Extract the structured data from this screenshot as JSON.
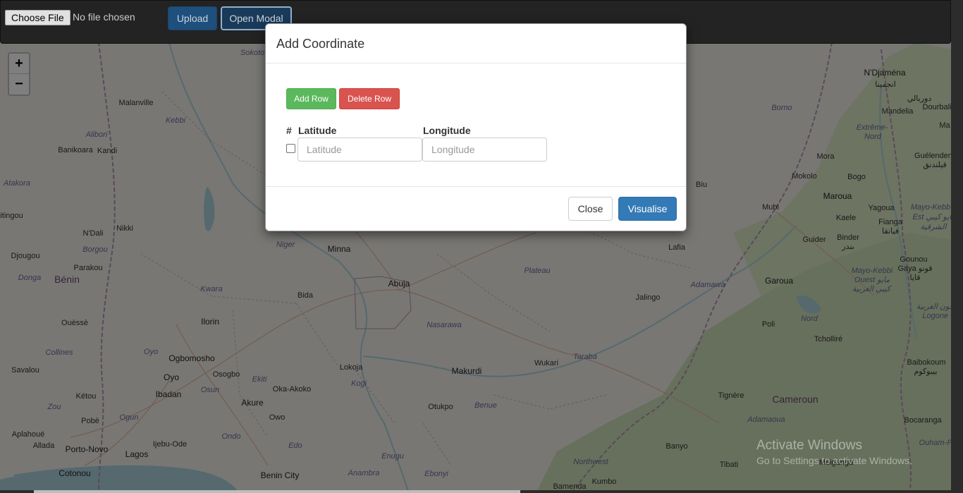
{
  "toolbar": {
    "file_button_label": "Choose File",
    "file_status": "No file chosen",
    "upload_label": "Upload",
    "open_modal_label": "Open Modal"
  },
  "map": {
    "zoom_in": "+",
    "zoom_out": "−",
    "places": [
      {
        "name": "Sokoto",
        "kind": "region"
      },
      {
        "name": "Malanville",
        "kind": "town"
      },
      {
        "name": "Kebbi",
        "kind": "region"
      },
      {
        "name": "Alibori",
        "kind": "region"
      },
      {
        "name": "Banikoara",
        "kind": "town"
      },
      {
        "name": "Kandi",
        "kind": "town"
      },
      {
        "name": "Atakora",
        "kind": "region"
      },
      {
        "name": "titingou",
        "kind": "town"
      },
      {
        "name": "Nikki",
        "kind": "town"
      },
      {
        "name": "N'Dali",
        "kind": "town"
      },
      {
        "name": "Borgou",
        "kind": "region"
      },
      {
        "name": "Djougou",
        "kind": "town"
      },
      {
        "name": "Parakou",
        "kind": "town"
      },
      {
        "name": "Donga",
        "kind": "region"
      },
      {
        "name": "Bénin",
        "kind": "country"
      },
      {
        "name": "Kwara",
        "kind": "region"
      },
      {
        "name": "Niger",
        "kind": "region"
      },
      {
        "name": "Minna",
        "kind": "city"
      },
      {
        "name": "Bida",
        "kind": "town"
      },
      {
        "name": "Abuja",
        "kind": "city"
      },
      {
        "name": "Plateau",
        "kind": "region"
      },
      {
        "name": "Lafia",
        "kind": "town"
      },
      {
        "name": "Ouèssè",
        "kind": "town"
      },
      {
        "name": "Ilorin",
        "kind": "city"
      },
      {
        "name": "Nasarawa",
        "kind": "region"
      },
      {
        "name": "Jalingo",
        "kind": "town"
      },
      {
        "name": "Adamawa",
        "kind": "region"
      },
      {
        "name": "Collines",
        "kind": "region"
      },
      {
        "name": "Oyo",
        "kind": "region"
      },
      {
        "name": "Ogbomosho",
        "kind": "city"
      },
      {
        "name": "Savalou",
        "kind": "town"
      },
      {
        "name": "Oyo",
        "kind": "city"
      },
      {
        "name": "Osogbo",
        "kind": "town"
      },
      {
        "name": "Ekiti",
        "kind": "region"
      },
      {
        "name": "Lokoja",
        "kind": "town"
      },
      {
        "name": "Makurdi",
        "kind": "city"
      },
      {
        "name": "Wukari",
        "kind": "town"
      },
      {
        "name": "Taraba",
        "kind": "region"
      },
      {
        "name": "Ibadan",
        "kind": "city"
      },
      {
        "name": "Osun",
        "kind": "region"
      },
      {
        "name": "Oka-Akoko",
        "kind": "town"
      },
      {
        "name": "Kogi",
        "kind": "region"
      },
      {
        "name": "Kétou",
        "kind": "town"
      },
      {
        "name": "Akure",
        "kind": "city"
      },
      {
        "name": "Benue",
        "kind": "region"
      },
      {
        "name": "Otukpo",
        "kind": "town"
      },
      {
        "name": "Zou",
        "kind": "region"
      },
      {
        "name": "Ogun",
        "kind": "region"
      },
      {
        "name": "Owo",
        "kind": "town"
      },
      {
        "name": "Pobè",
        "kind": "town"
      },
      {
        "name": "Aplahoué",
        "kind": "town"
      },
      {
        "name": "Ondo",
        "kind": "region"
      },
      {
        "name": "Edo",
        "kind": "region"
      },
      {
        "name": "Ijebu-Ode",
        "kind": "town"
      },
      {
        "name": "Allada",
        "kind": "town"
      },
      {
        "name": "Porto-Novo",
        "kind": "city"
      },
      {
        "name": "Lagos",
        "kind": "city"
      },
      {
        "name": "Enugu",
        "kind": "region"
      },
      {
        "name": "Ebonyi",
        "kind": "region"
      },
      {
        "name": "Cotonou",
        "kind": "city"
      },
      {
        "name": "Anambra",
        "kind": "region"
      },
      {
        "name": "Benin City",
        "kind": "city"
      },
      {
        "name": "N'Djaména",
        "kind": "city"
      },
      {
        "name": "انجمينا",
        "kind": "town"
      },
      {
        "name": "Borno",
        "kind": "region"
      },
      {
        "name": "Mandelia",
        "kind": "town"
      },
      {
        "name": "Dourbali",
        "kind": "town"
      },
      {
        "name": "دوربالي",
        "kind": "town"
      },
      {
        "name": "Extrême-",
        "kind": "region"
      },
      {
        "name": "Nord",
        "kind": "region"
      },
      {
        "name": "Ma",
        "kind": "town"
      },
      {
        "name": "Guélendeng",
        "kind": "town"
      },
      {
        "name": "قيلندنق",
        "kind": "town"
      },
      {
        "name": "Mora",
        "kind": "town"
      },
      {
        "name": "Mokolo",
        "kind": "town"
      },
      {
        "name": "Bogo",
        "kind": "town"
      },
      {
        "name": "Biu",
        "kind": "town"
      },
      {
        "name": "Maroua",
        "kind": "city"
      },
      {
        "name": "Mubi",
        "kind": "town"
      },
      {
        "name": "Yagoua",
        "kind": "town"
      },
      {
        "name": "Mayo-Kebb",
        "kind": "region"
      },
      {
        "name": "Est مايو كيبي",
        "kind": "region"
      },
      {
        "name": "الشرقية",
        "kind": "region"
      },
      {
        "name": "Kaele",
        "kind": "town"
      },
      {
        "name": "Fianga",
        "kind": "town"
      },
      {
        "name": "فيانقا",
        "kind": "town"
      },
      {
        "name": "Guider",
        "kind": "town"
      },
      {
        "name": "Binder",
        "kind": "town"
      },
      {
        "name": "بندر",
        "kind": "town"
      },
      {
        "name": "Gounou",
        "kind": "town"
      },
      {
        "name": "Gaya قونو",
        "kind": "town"
      },
      {
        "name": "قايا",
        "kind": "town"
      },
      {
        "name": "Garoua",
        "kind": "city"
      },
      {
        "name": "Mayo-Kebbi",
        "kind": "region"
      },
      {
        "name": "Ouest مايو",
        "kind": "region"
      },
      {
        "name": "كيبي الغربية",
        "kind": "region"
      },
      {
        "name": "اللوغون الغربية",
        "kind": "region"
      },
      {
        "name": "Logone Occ",
        "kind": "region"
      },
      {
        "name": "Poli",
        "kind": "town"
      },
      {
        "name": "Nord",
        "kind": "region"
      },
      {
        "name": "Tcholliré",
        "kind": "town"
      },
      {
        "name": "Baibokoum",
        "kind": "town"
      },
      {
        "name": "بيبوكوم",
        "kind": "town"
      },
      {
        "name": "Tignère",
        "kind": "town"
      },
      {
        "name": "Cameroun",
        "kind": "country"
      },
      {
        "name": "Adamaoua",
        "kind": "region"
      },
      {
        "name": "Bocaranga",
        "kind": "town"
      },
      {
        "name": "Ouham-P",
        "kind": "region"
      },
      {
        "name": "Banyo",
        "kind": "town"
      },
      {
        "name": "Northwest",
        "kind": "region"
      },
      {
        "name": "Tibati",
        "kind": "town"
      },
      {
        "name": "Meiganga",
        "kind": "town"
      },
      {
        "name": "Bamenda",
        "kind": "town"
      },
      {
        "name": "Kumbo",
        "kind": "town"
      }
    ]
  },
  "watermark": {
    "line1": "Activate Windows",
    "line2": "Go to Settings to activate Windows."
  },
  "modal": {
    "title": "Add Coordinate",
    "add_row_label": "Add Row",
    "delete_row_label": "Delete Row",
    "columns": [
      "#",
      "Latitude",
      "Longitude"
    ],
    "latitude_placeholder": "Latitude",
    "longitude_placeholder": "Longitude",
    "close_label": "Close",
    "visualise_label": "Visualise"
  }
}
